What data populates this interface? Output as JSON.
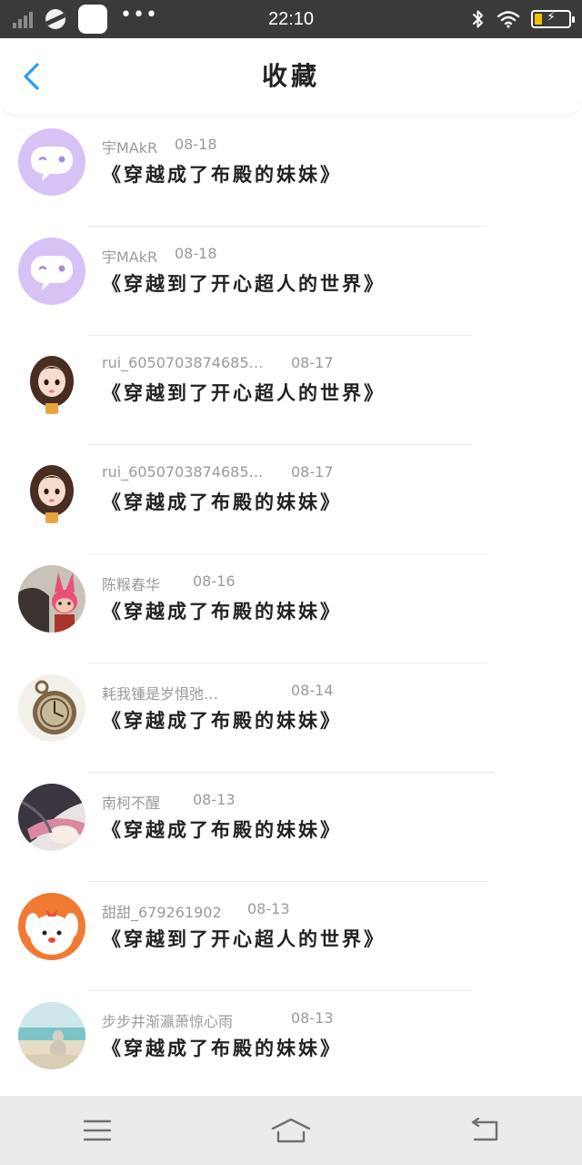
{
  "status_bar": {
    "time": "22:10",
    "left_icons": [
      "signal-icon",
      "app-icon",
      "app-icon",
      "more-dots-icon"
    ],
    "right_icons": [
      "bluetooth-icon",
      "wifi-icon",
      "battery-charging-icon"
    ],
    "more_dots": "•••",
    "battery_bolt": "⚡",
    "battery_fill_color": "#f2c200"
  },
  "header": {
    "title": "收藏",
    "back_icon": "chevron-left-icon",
    "accent": "#2a9cf5"
  },
  "items": [
    {
      "name": "宇MAkR",
      "date": "08-18",
      "title": "《穿越成了布殿的妹妹》",
      "avatar": "purple-chat-bubble"
    },
    {
      "name": "宇MAkR",
      "date": "08-18",
      "title": "《穿越到了开心超人的世界》",
      "avatar": "purple-chat-bubble"
    },
    {
      "name": "rui_6050703874685…",
      "date": "08-17",
      "title": "《穿越到了开心超人的世界》",
      "avatar": "cartoon-girl"
    },
    {
      "name": "rui_6050703874685…",
      "date": "08-17",
      "title": "《穿越成了布殿的妹妹》",
      "avatar": "cartoon-girl"
    },
    {
      "name": "陈糇春华",
      "date": "08-16",
      "title": "《穿越成了布殿的妹妹》",
      "avatar": "pink-toy"
    },
    {
      "name": "耗我锺是岁惧弛…",
      "date": "08-14",
      "title": "《穿越成了布殿的妹妹》",
      "avatar": "pocket-watch"
    },
    {
      "name": "南柯不醒",
      "date": "08-13",
      "title": "《穿越成了布殿的妹妹》",
      "avatar": "anime-figure"
    },
    {
      "name": "甜甜_679261902",
      "date": "08-13",
      "title": "《穿越到了开心超人的世界》",
      "avatar": "cartoon-dog"
    },
    {
      "name": "步步井渐瀛萧惊心雨",
      "date": "08-13",
      "title": "《穿越成了布殿的妹妹》",
      "avatar": "beach-scene"
    }
  ],
  "nav_bar": {
    "icons": [
      "menu-icon",
      "home-icon",
      "back-icon"
    ]
  }
}
